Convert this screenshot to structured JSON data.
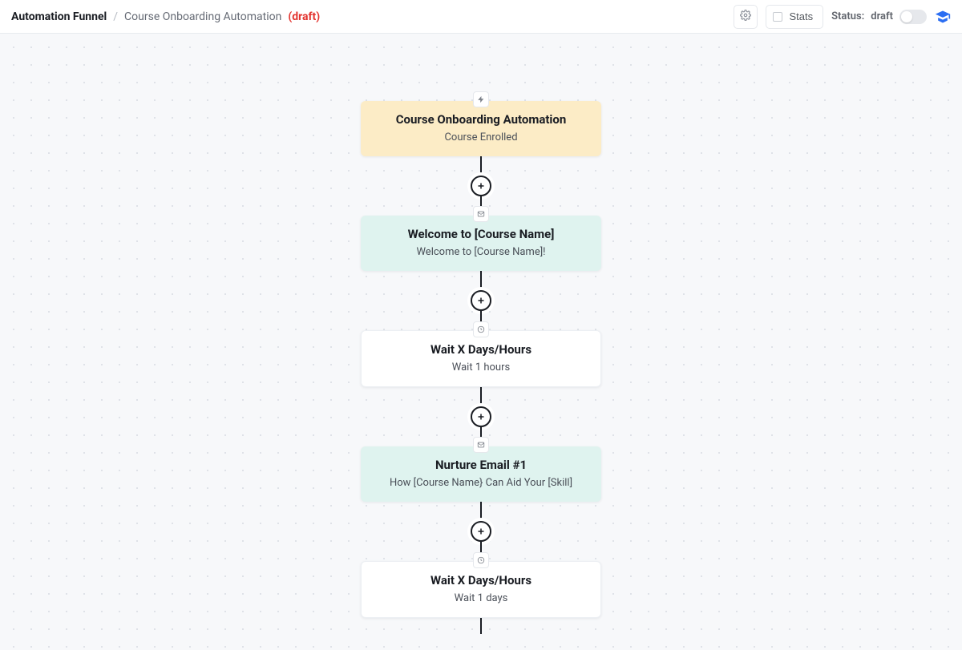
{
  "breadcrumb": {
    "root": "Automation Funnel",
    "separator": "/",
    "current": "Course Onboarding Automation",
    "draft_label": "(draft)"
  },
  "topbar": {
    "stats_label": "Stats",
    "status_prefix": "Status:",
    "status_value": "draft"
  },
  "nodes": {
    "trigger": {
      "title": "Course Onboarding Automation",
      "subtitle": "Course Enrolled",
      "icon": "bolt-icon"
    },
    "email1": {
      "title": "Welcome to [Course Name]",
      "subtitle": "Welcome to [Course Name]!",
      "icon": "mail-icon"
    },
    "wait1": {
      "title": "Wait X Days/Hours",
      "subtitle": "Wait 1 hours",
      "icon": "clock-icon"
    },
    "email2": {
      "title": "Nurture Email #1",
      "subtitle": "How [Course Name} Can Aid Your [Skill]",
      "icon": "mail-icon"
    },
    "wait2": {
      "title": "Wait X Days/Hours",
      "subtitle": "Wait 1 days",
      "icon": "clock-icon"
    }
  },
  "colors": {
    "trigger_bg": "#fcecc6",
    "email_bg": "#dff3ef",
    "wait_bg": "#ffffff",
    "accent_blue": "#2b6ef2",
    "draft_red": "#e3342f"
  }
}
